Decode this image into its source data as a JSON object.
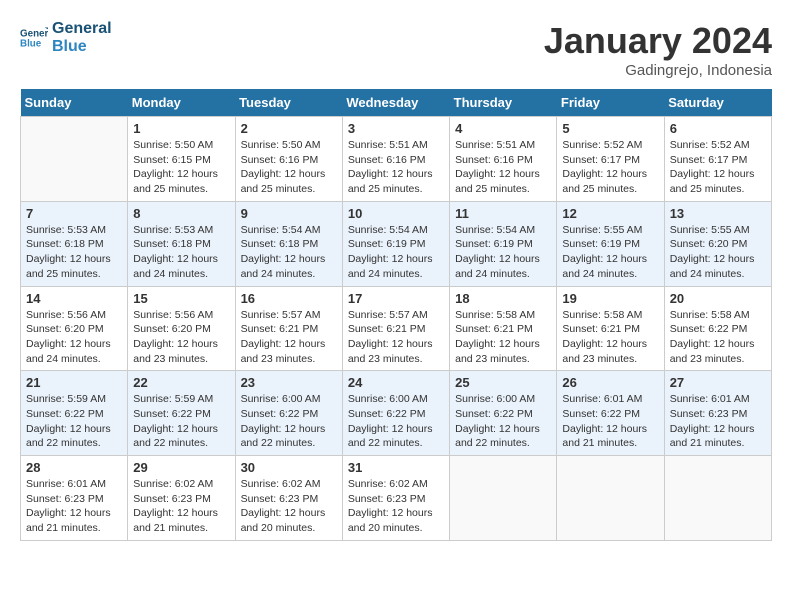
{
  "header": {
    "logo_line1": "General",
    "logo_line2": "Blue",
    "month": "January 2024",
    "location": "Gadingrejo, Indonesia"
  },
  "weekdays": [
    "Sunday",
    "Monday",
    "Tuesday",
    "Wednesday",
    "Thursday",
    "Friday",
    "Saturday"
  ],
  "weeks": [
    [
      {
        "day": "",
        "empty": true
      },
      {
        "day": "1",
        "sunrise": "Sunrise: 5:50 AM",
        "sunset": "Sunset: 6:15 PM",
        "daylight": "Daylight: 12 hours and 25 minutes."
      },
      {
        "day": "2",
        "sunrise": "Sunrise: 5:50 AM",
        "sunset": "Sunset: 6:16 PM",
        "daylight": "Daylight: 12 hours and 25 minutes."
      },
      {
        "day": "3",
        "sunrise": "Sunrise: 5:51 AM",
        "sunset": "Sunset: 6:16 PM",
        "daylight": "Daylight: 12 hours and 25 minutes."
      },
      {
        "day": "4",
        "sunrise": "Sunrise: 5:51 AM",
        "sunset": "Sunset: 6:16 PM",
        "daylight": "Daylight: 12 hours and 25 minutes."
      },
      {
        "day": "5",
        "sunrise": "Sunrise: 5:52 AM",
        "sunset": "Sunset: 6:17 PM",
        "daylight": "Daylight: 12 hours and 25 minutes."
      },
      {
        "day": "6",
        "sunrise": "Sunrise: 5:52 AM",
        "sunset": "Sunset: 6:17 PM",
        "daylight": "Daylight: 12 hours and 25 minutes."
      }
    ],
    [
      {
        "day": "7",
        "sunrise": "Sunrise: 5:53 AM",
        "sunset": "Sunset: 6:18 PM",
        "daylight": "Daylight: 12 hours and 25 minutes."
      },
      {
        "day": "8",
        "sunrise": "Sunrise: 5:53 AM",
        "sunset": "Sunset: 6:18 PM",
        "daylight": "Daylight: 12 hours and 24 minutes."
      },
      {
        "day": "9",
        "sunrise": "Sunrise: 5:54 AM",
        "sunset": "Sunset: 6:18 PM",
        "daylight": "Daylight: 12 hours and 24 minutes."
      },
      {
        "day": "10",
        "sunrise": "Sunrise: 5:54 AM",
        "sunset": "Sunset: 6:19 PM",
        "daylight": "Daylight: 12 hours and 24 minutes."
      },
      {
        "day": "11",
        "sunrise": "Sunrise: 5:54 AM",
        "sunset": "Sunset: 6:19 PM",
        "daylight": "Daylight: 12 hours and 24 minutes."
      },
      {
        "day": "12",
        "sunrise": "Sunrise: 5:55 AM",
        "sunset": "Sunset: 6:19 PM",
        "daylight": "Daylight: 12 hours and 24 minutes."
      },
      {
        "day": "13",
        "sunrise": "Sunrise: 5:55 AM",
        "sunset": "Sunset: 6:20 PM",
        "daylight": "Daylight: 12 hours and 24 minutes."
      }
    ],
    [
      {
        "day": "14",
        "sunrise": "Sunrise: 5:56 AM",
        "sunset": "Sunset: 6:20 PM",
        "daylight": "Daylight: 12 hours and 24 minutes."
      },
      {
        "day": "15",
        "sunrise": "Sunrise: 5:56 AM",
        "sunset": "Sunset: 6:20 PM",
        "daylight": "Daylight: 12 hours and 23 minutes."
      },
      {
        "day": "16",
        "sunrise": "Sunrise: 5:57 AM",
        "sunset": "Sunset: 6:21 PM",
        "daylight": "Daylight: 12 hours and 23 minutes."
      },
      {
        "day": "17",
        "sunrise": "Sunrise: 5:57 AM",
        "sunset": "Sunset: 6:21 PM",
        "daylight": "Daylight: 12 hours and 23 minutes."
      },
      {
        "day": "18",
        "sunrise": "Sunrise: 5:58 AM",
        "sunset": "Sunset: 6:21 PM",
        "daylight": "Daylight: 12 hours and 23 minutes."
      },
      {
        "day": "19",
        "sunrise": "Sunrise: 5:58 AM",
        "sunset": "Sunset: 6:21 PM",
        "daylight": "Daylight: 12 hours and 23 minutes."
      },
      {
        "day": "20",
        "sunrise": "Sunrise: 5:58 AM",
        "sunset": "Sunset: 6:22 PM",
        "daylight": "Daylight: 12 hours and 23 minutes."
      }
    ],
    [
      {
        "day": "21",
        "sunrise": "Sunrise: 5:59 AM",
        "sunset": "Sunset: 6:22 PM",
        "daylight": "Daylight: 12 hours and 22 minutes."
      },
      {
        "day": "22",
        "sunrise": "Sunrise: 5:59 AM",
        "sunset": "Sunset: 6:22 PM",
        "daylight": "Daylight: 12 hours and 22 minutes."
      },
      {
        "day": "23",
        "sunrise": "Sunrise: 6:00 AM",
        "sunset": "Sunset: 6:22 PM",
        "daylight": "Daylight: 12 hours and 22 minutes."
      },
      {
        "day": "24",
        "sunrise": "Sunrise: 6:00 AM",
        "sunset": "Sunset: 6:22 PM",
        "daylight": "Daylight: 12 hours and 22 minutes."
      },
      {
        "day": "25",
        "sunrise": "Sunrise: 6:00 AM",
        "sunset": "Sunset: 6:22 PM",
        "daylight": "Daylight: 12 hours and 22 minutes."
      },
      {
        "day": "26",
        "sunrise": "Sunrise: 6:01 AM",
        "sunset": "Sunset: 6:22 PM",
        "daylight": "Daylight: 12 hours and 21 minutes."
      },
      {
        "day": "27",
        "sunrise": "Sunrise: 6:01 AM",
        "sunset": "Sunset: 6:23 PM",
        "daylight": "Daylight: 12 hours and 21 minutes."
      }
    ],
    [
      {
        "day": "28",
        "sunrise": "Sunrise: 6:01 AM",
        "sunset": "Sunset: 6:23 PM",
        "daylight": "Daylight: 12 hours and 21 minutes."
      },
      {
        "day": "29",
        "sunrise": "Sunrise: 6:02 AM",
        "sunset": "Sunset: 6:23 PM",
        "daylight": "Daylight: 12 hours and 21 minutes."
      },
      {
        "day": "30",
        "sunrise": "Sunrise: 6:02 AM",
        "sunset": "Sunset: 6:23 PM",
        "daylight": "Daylight: 12 hours and 20 minutes."
      },
      {
        "day": "31",
        "sunrise": "Sunrise: 6:02 AM",
        "sunset": "Sunset: 6:23 PM",
        "daylight": "Daylight: 12 hours and 20 minutes."
      },
      {
        "day": "",
        "empty": true
      },
      {
        "day": "",
        "empty": true
      },
      {
        "day": "",
        "empty": true
      }
    ]
  ]
}
